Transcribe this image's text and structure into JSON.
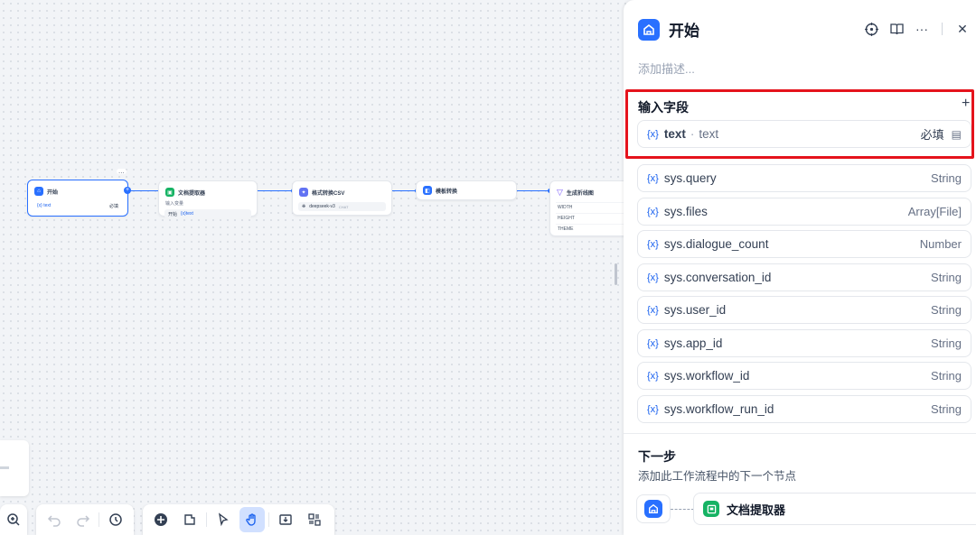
{
  "canvas": {
    "nodes": {
      "start": {
        "title": "开始",
        "var_label": "{x} text",
        "required": "必填"
      },
      "doc_extractor": {
        "title": "文档提取器",
        "input_label": "输入变量",
        "input_source": "开始",
        "input_var": "{x}text"
      },
      "csv_format": {
        "title": "格式转换CSV",
        "model": "deepseek-v3",
        "model_tag": "CHAT"
      },
      "template": {
        "title": "模板转换"
      },
      "line_chart": {
        "title": "生成折线图",
        "params": [
          "WIDTH",
          "HEIGHT",
          "THEME"
        ]
      }
    },
    "more_tag": "..."
  },
  "panel": {
    "title": "开始",
    "description_placeholder": "添加描述...",
    "input_section": {
      "title": "输入字段",
      "add": "+",
      "field": {
        "name": "text",
        "separator": "·",
        "alias": "text",
        "required": "必填"
      }
    },
    "sys_vars": [
      {
        "name": "sys.query",
        "type": "String"
      },
      {
        "name": "sys.files",
        "type": "Array[File]"
      },
      {
        "name": "sys.dialogue_count",
        "type": "Number"
      },
      {
        "name": "sys.conversation_id",
        "type": "String"
      },
      {
        "name": "sys.user_id",
        "type": "String"
      },
      {
        "name": "sys.app_id",
        "type": "String"
      },
      {
        "name": "sys.workflow_id",
        "type": "String"
      },
      {
        "name": "sys.workflow_run_id",
        "type": "String"
      }
    ],
    "var_prefix": "{x}",
    "next_step": {
      "title": "下一步",
      "description": "添加此工作流程中的下一个节点",
      "next_node": "文档提取器"
    }
  },
  "colors": {
    "accent": "#2970ff",
    "highlight": "#e5131c",
    "green": "#16b364"
  }
}
